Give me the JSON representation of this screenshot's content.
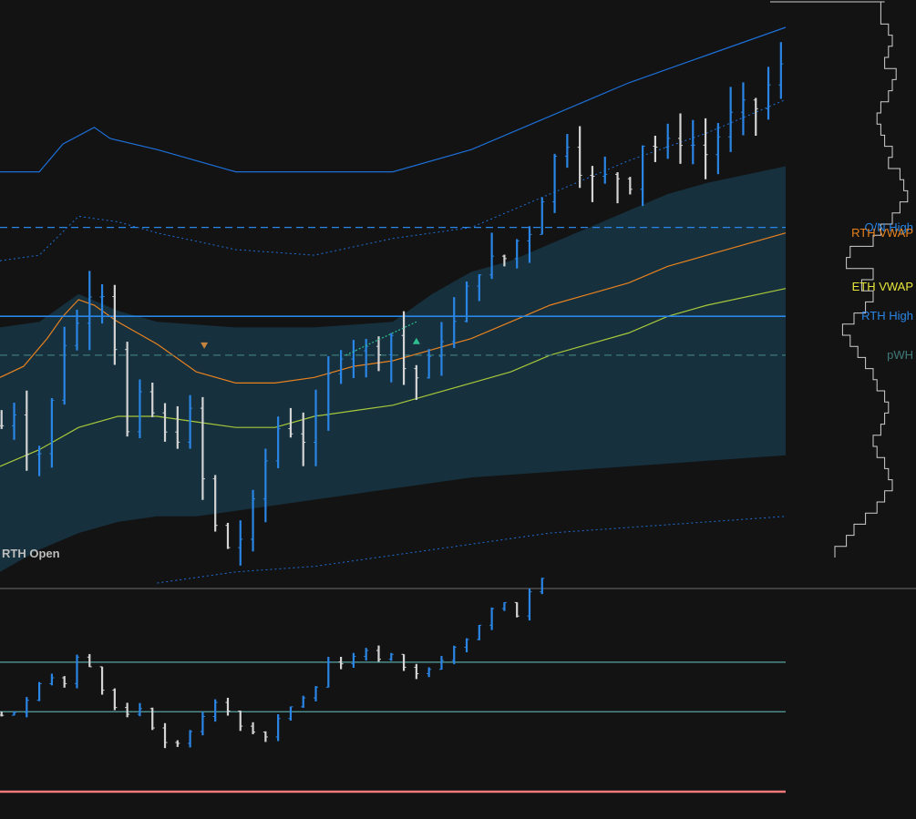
{
  "colors": {
    "background": "#131313",
    "up_bar": "#2a86e6",
    "down_bar": "#d4d4d4",
    "band_fill": "#16303e",
    "outer_band": "#1d6fd6",
    "rth_vwap": "#e8821f",
    "eth_vwap": "#a8c83a",
    "on_high": "#2a86e6",
    "rth_high": "#2a86e6",
    "pwh": "#3f7a78",
    "rth_open": "#bdbdbd",
    "lower_hline": "#5aa3a3",
    "lower_baseline": "#f07a7a",
    "profile": "#cfcfcf",
    "divergence": "#2fbf8f",
    "marker_down": "#c8853f",
    "marker_up": "#2fbf8f"
  },
  "labels": {
    "on_high": "O/N High",
    "rth_vwap": "RTH VWAP",
    "rth_high": "RTH High",
    "eth_vwap": "ETH VWAP",
    "pwh": "pWH",
    "rth_open": "RTH Open"
  },
  "icons": {
    "marker_down": "triangle-down-icon",
    "marker_up": "triangle-up-icon"
  },
  "chart_data": [
    {
      "type": "bar",
      "subtype": "ohlc-price-bars",
      "panel": "upper",
      "ylim": [
        0,
        100
      ],
      "x_range": [
        0,
        100
      ],
      "bars": {
        "x_step": 1.6,
        "x_start": 0.2,
        "anchors": [
          [
            0,
            28
          ],
          [
            2.5,
            32
          ],
          [
            4,
            19
          ],
          [
            6,
            28
          ],
          [
            8,
            43
          ],
          [
            10,
            47
          ],
          [
            12,
            55
          ],
          [
            14,
            50
          ],
          [
            16,
            26
          ],
          [
            18,
            34
          ],
          [
            20,
            29
          ],
          [
            22,
            24
          ],
          [
            24,
            32
          ],
          [
            26,
            17
          ],
          [
            28,
            7
          ],
          [
            30,
            6
          ],
          [
            32,
            13
          ],
          [
            34,
            23
          ],
          [
            36,
            30
          ],
          [
            38,
            25
          ],
          [
            40,
            28
          ],
          [
            42,
            38
          ],
          [
            44,
            43
          ],
          [
            46,
            42
          ],
          [
            48,
            42
          ],
          [
            50,
            45
          ],
          [
            52,
            36
          ],
          [
            54,
            38
          ],
          [
            56,
            44
          ],
          [
            58,
            47
          ],
          [
            60,
            55
          ],
          [
            62,
            58
          ],
          [
            64,
            58
          ],
          [
            66,
            62
          ],
          [
            68,
            64
          ],
          [
            70,
            75
          ],
          [
            72,
            80
          ],
          [
            74,
            74
          ],
          [
            76,
            72
          ],
          [
            78,
            74
          ],
          [
            80,
            71
          ],
          [
            82,
            80
          ],
          [
            84,
            78
          ],
          [
            86,
            80
          ],
          [
            88,
            79
          ],
          [
            90,
            77
          ],
          [
            92,
            82
          ],
          [
            94,
            86
          ],
          [
            96,
            85
          ],
          [
            98,
            90
          ],
          [
            100,
            94
          ]
        ]
      },
      "lines": {
        "outer_upper": [
          [
            0,
            74
          ],
          [
            5,
            74
          ],
          [
            8,
            79
          ],
          [
            12,
            82
          ],
          [
            14,
            80
          ],
          [
            20,
            78
          ],
          [
            30,
            74
          ],
          [
            40,
            74
          ],
          [
            50,
            74
          ],
          [
            60,
            78
          ],
          [
            70,
            84
          ],
          [
            80,
            90
          ],
          [
            90,
            95
          ],
          [
            100,
            100
          ]
        ],
        "outer_lower": [
          [
            0,
            44
          ],
          [
            5,
            43
          ],
          [
            10,
            45
          ],
          [
            15,
            42
          ],
          [
            20,
            40
          ],
          [
            30,
            39
          ],
          [
            40,
            38
          ],
          [
            50,
            38
          ],
          [
            60,
            39
          ],
          [
            70,
            40
          ],
          [
            80,
            41
          ],
          [
            90,
            42
          ],
          [
            100,
            42
          ]
        ],
        "inner_dotted_upper": [
          [
            0,
            58
          ],
          [
            5,
            59
          ],
          [
            10,
            66
          ],
          [
            15,
            65
          ],
          [
            20,
            63
          ],
          [
            30,
            60
          ],
          [
            40,
            59
          ],
          [
            50,
            62
          ],
          [
            60,
            64
          ],
          [
            70,
            70
          ],
          [
            80,
            76
          ],
          [
            90,
            81
          ],
          [
            100,
            87
          ]
        ],
        "inner_dotted_lower": [
          [
            20,
            0
          ],
          [
            30,
            2
          ],
          [
            40,
            3
          ],
          [
            50,
            5
          ],
          [
            60,
            7
          ],
          [
            70,
            9
          ],
          [
            80,
            10
          ],
          [
            90,
            11
          ],
          [
            100,
            12
          ]
        ],
        "rth_vwap": [
          [
            0,
            37
          ],
          [
            3,
            39
          ],
          [
            6,
            44
          ],
          [
            8,
            48
          ],
          [
            10,
            51
          ],
          [
            12,
            50
          ],
          [
            15,
            47
          ],
          [
            20,
            43
          ],
          [
            25,
            38
          ],
          [
            30,
            36
          ],
          [
            35,
            36
          ],
          [
            40,
            37
          ],
          [
            45,
            39
          ],
          [
            50,
            40
          ],
          [
            55,
            42
          ],
          [
            60,
            44
          ],
          [
            65,
            47
          ],
          [
            70,
            50
          ],
          [
            75,
            52
          ],
          [
            80,
            54
          ],
          [
            85,
            57
          ],
          [
            90,
            59
          ],
          [
            100,
            63
          ]
        ],
        "eth_vwap": [
          [
            0,
            21
          ],
          [
            5,
            24
          ],
          [
            10,
            28
          ],
          [
            15,
            30
          ],
          [
            20,
            30
          ],
          [
            25,
            29
          ],
          [
            30,
            28
          ],
          [
            35,
            28
          ],
          [
            40,
            30
          ],
          [
            45,
            31
          ],
          [
            50,
            32
          ],
          [
            55,
            34
          ],
          [
            60,
            36
          ],
          [
            65,
            38
          ],
          [
            70,
            41
          ],
          [
            75,
            43
          ],
          [
            80,
            45
          ],
          [
            85,
            48
          ],
          [
            90,
            50
          ],
          [
            100,
            53
          ]
        ]
      },
      "band": {
        "upper": [
          [
            0,
            46
          ],
          [
            5,
            47
          ],
          [
            10,
            52
          ],
          [
            15,
            49
          ],
          [
            20,
            47
          ],
          [
            30,
            46
          ],
          [
            40,
            46
          ],
          [
            50,
            47
          ],
          [
            55,
            52
          ],
          [
            60,
            56
          ],
          [
            65,
            58
          ],
          [
            70,
            61
          ],
          [
            75,
            64
          ],
          [
            80,
            67
          ],
          [
            85,
            70
          ],
          [
            90,
            72
          ],
          [
            100,
            75
          ]
        ],
        "lower": [
          [
            0,
            2
          ],
          [
            5,
            6
          ],
          [
            10,
            9
          ],
          [
            15,
            11
          ],
          [
            20,
            12
          ],
          [
            25,
            12
          ],
          [
            30,
            13
          ],
          [
            40,
            15
          ],
          [
            50,
            17
          ],
          [
            60,
            19
          ],
          [
            70,
            20
          ],
          [
            80,
            21
          ],
          [
            90,
            22
          ],
          [
            100,
            23
          ]
        ]
      },
      "hlines": {
        "on_high": 64,
        "rth_high": 48,
        "pwh": 41
      },
      "rth_open": 4,
      "divergence": [
        [
          44,
          41
        ],
        [
          53,
          47
        ]
      ],
      "marker_down": [
        26,
        41
      ],
      "marker_up": [
        53,
        43
      ],
      "profile": [
        [
          100,
          -7
        ],
        [
          96,
          -8
        ],
        [
          94,
          -6
        ],
        [
          92,
          -5
        ],
        [
          90,
          -6
        ],
        [
          88,
          -7
        ],
        [
          86,
          -4
        ],
        [
          84,
          -5
        ],
        [
          82,
          -6
        ],
        [
          80,
          -8
        ],
        [
          78,
          -9
        ],
        [
          76,
          -8
        ],
        [
          74,
          -7
        ],
        [
          72,
          -5
        ],
        [
          70,
          -6
        ],
        [
          68,
          -3
        ],
        [
          66,
          -2
        ],
        [
          64,
          -1
        ],
        [
          62,
          -3
        ],
        [
          60,
          -5
        ],
        [
          58,
          -8
        ],
        [
          56,
          -10
        ],
        [
          54,
          -16
        ],
        [
          52,
          -17
        ],
        [
          50,
          -10
        ],
        [
          48,
          -13
        ],
        [
          46,
          -10
        ],
        [
          44,
          -12
        ],
        [
          42,
          -15
        ],
        [
          40,
          -18
        ],
        [
          38,
          -16
        ],
        [
          36,
          -14
        ],
        [
          34,
          -12
        ],
        [
          32,
          -10
        ],
        [
          30,
          -9
        ],
        [
          28,
          -7
        ],
        [
          26,
          -6
        ],
        [
          24,
          -7
        ],
        [
          22,
          -8
        ],
        [
          20,
          -10
        ],
        [
          18,
          -9
        ],
        [
          16,
          -7
        ],
        [
          14,
          -6
        ],
        [
          12,
          -5
        ],
        [
          10,
          -7
        ],
        [
          8,
          -9
        ],
        [
          6,
          -12
        ],
        [
          4,
          -15
        ],
        [
          2,
          -17
        ],
        [
          0,
          -20
        ]
      ]
    },
    {
      "type": "bar",
      "subtype": "ohlc-price-bars",
      "panel": "lower",
      "ylim": [
        0,
        100
      ],
      "x_range": [
        0,
        100
      ],
      "bars": {
        "x_step": 1.6,
        "x_start": 0.2,
        "end_x": 70,
        "anchors": [
          [
            0,
            40
          ],
          [
            2,
            42
          ],
          [
            4,
            50
          ],
          [
            6,
            62
          ],
          [
            8,
            55
          ],
          [
            10,
            72
          ],
          [
            12,
            63
          ],
          [
            14,
            45
          ],
          [
            16,
            40
          ],
          [
            18,
            44
          ],
          [
            20,
            28
          ],
          [
            22,
            24
          ],
          [
            24,
            30
          ],
          [
            26,
            40
          ],
          [
            28,
            50
          ],
          [
            30,
            36
          ],
          [
            32,
            32
          ],
          [
            34,
            28
          ],
          [
            36,
            42
          ],
          [
            38,
            48
          ],
          [
            40,
            54
          ],
          [
            42,
            70
          ],
          [
            44,
            66
          ],
          [
            46,
            75
          ],
          [
            48,
            70
          ],
          [
            50,
            72
          ],
          [
            52,
            63
          ],
          [
            54,
            62
          ],
          [
            56,
            68
          ],
          [
            58,
            76
          ],
          [
            60,
            82
          ],
          [
            62,
            94
          ],
          [
            64,
            100
          ],
          [
            66,
            92
          ],
          [
            68,
            110
          ],
          [
            70,
            113
          ]
        ]
      },
      "hlines": {
        "upper_level": 68,
        "lower_level": 42,
        "baseline": 0
      }
    }
  ]
}
